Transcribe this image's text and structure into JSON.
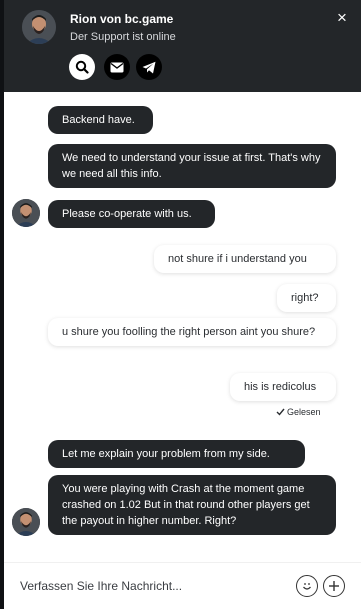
{
  "header": {
    "agent_name": "Rion von bc.game",
    "agent_status": "Der Support ist online",
    "icons": [
      "search-icon",
      "mail-icon",
      "telegram-icon",
      "close-icon"
    ],
    "close_glyph": "×"
  },
  "messages": [
    {
      "sender": "agent",
      "text": "Backend have."
    },
    {
      "sender": "agent",
      "text": "We need to understand your issue at first. That's why we need all this info."
    },
    {
      "sender": "agent",
      "text": "Please co-operate with us."
    },
    {
      "sender": "user",
      "text": "not shure if i understand you"
    },
    {
      "sender": "user",
      "text": "right?"
    },
    {
      "sender": "user",
      "text": "u shure you foolling the right person aint you shure?"
    },
    {
      "sender": "user",
      "text": "his is redicolus"
    },
    {
      "sender": "agent",
      "text": "Let me explain your problem from my side."
    },
    {
      "sender": "agent",
      "text": "You were playing with Crash at the moment game crashed on 1.02 But in that round other players get the payout in higher number. Right?"
    }
  ],
  "read_status": "Gelesen",
  "composer": {
    "placeholder": "Verfassen Sie Ihre Nachricht..."
  },
  "colors": {
    "header_bg": "#232629",
    "agent_bubble": "#232629",
    "user_bubble": "#ffffff"
  }
}
